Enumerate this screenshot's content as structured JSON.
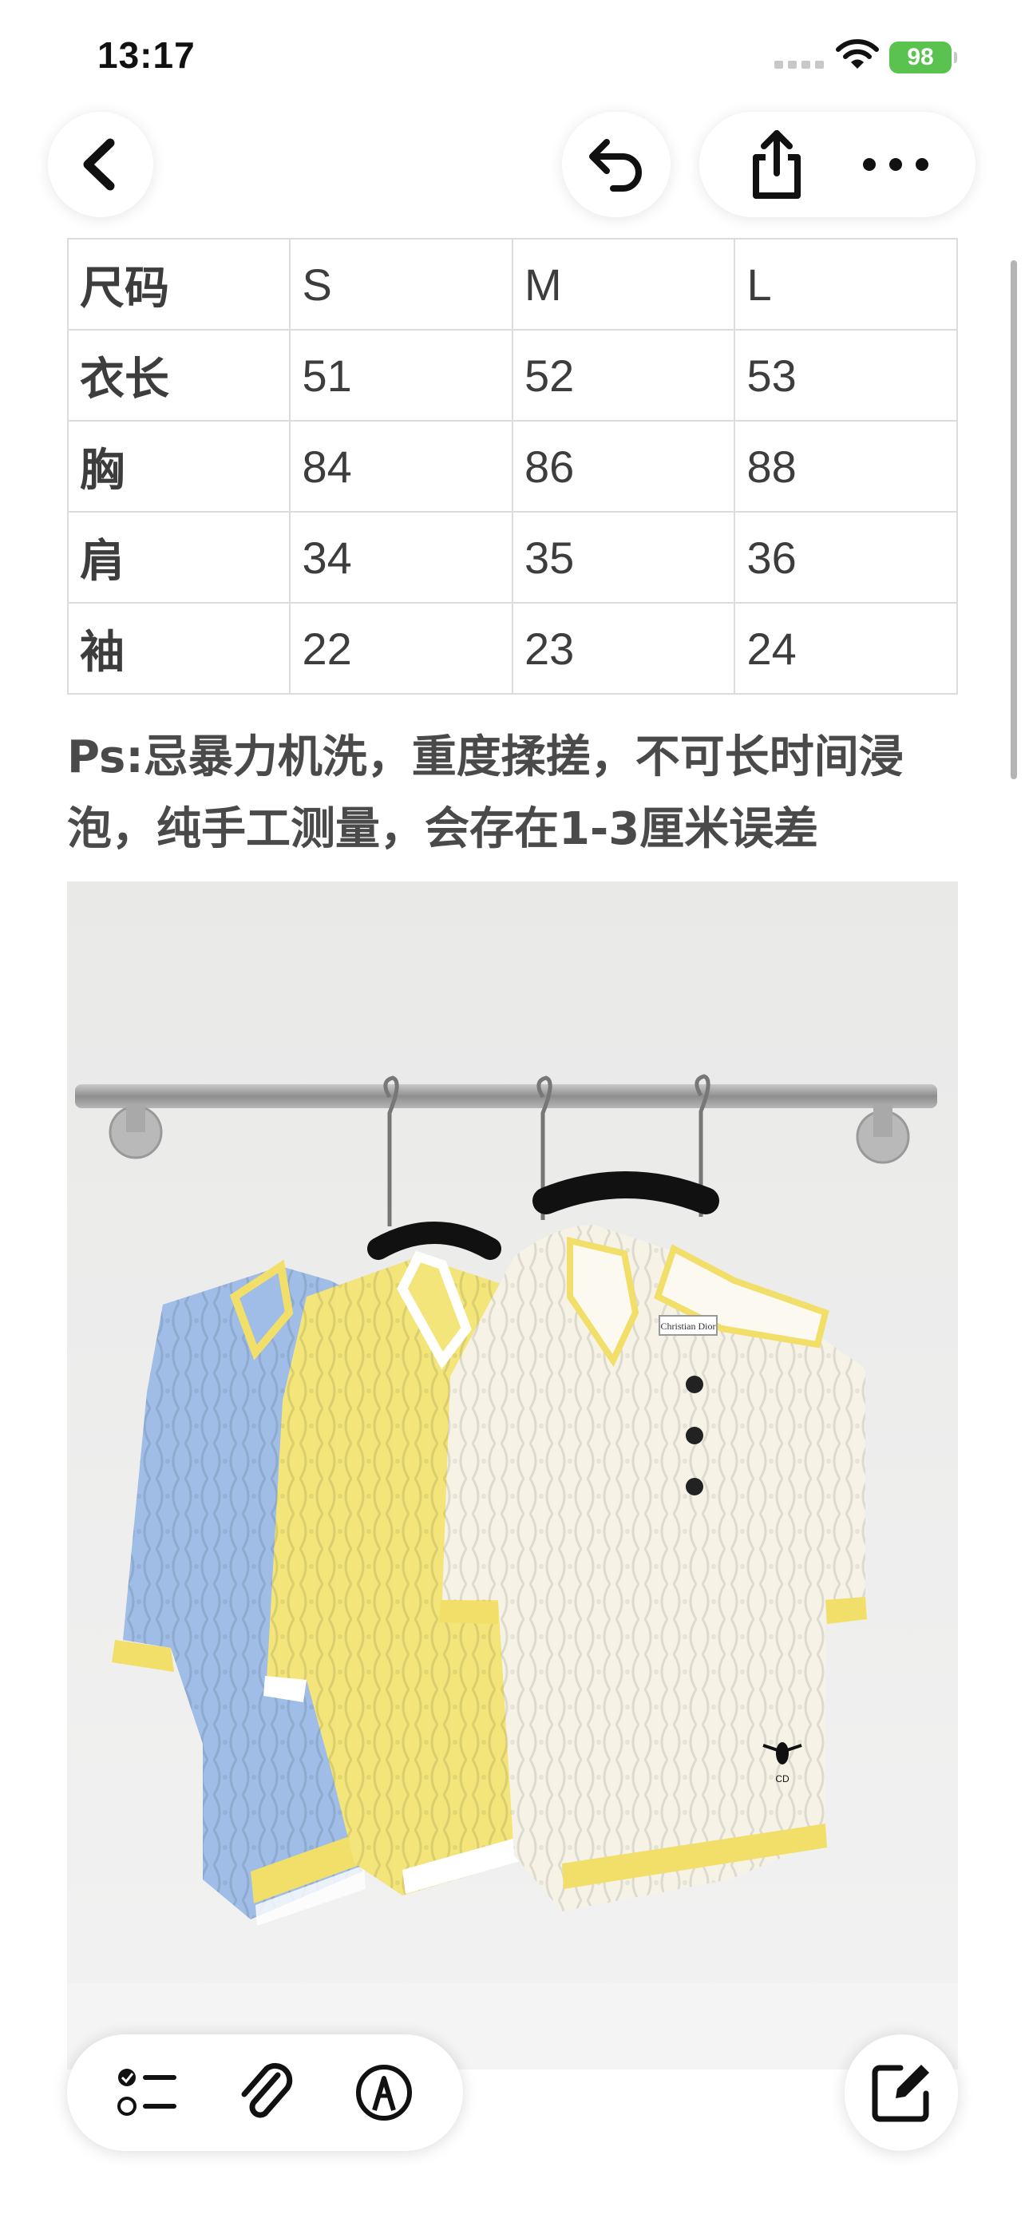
{
  "status_bar": {
    "time": "13:17",
    "battery": "98"
  },
  "nav": {
    "back_icon": "chevron-left-icon",
    "undo_icon": "undo-icon",
    "share_icon": "share-icon",
    "more_icon": "ellipsis-icon"
  },
  "table": {
    "rows": [
      [
        "尺码",
        "S",
        "M",
        "L"
      ],
      [
        "衣长",
        "51",
        "52",
        "53"
      ],
      [
        "胸",
        "84",
        "86",
        "88"
      ],
      [
        "肩",
        "34",
        "35",
        "36"
      ],
      [
        "袖",
        "22",
        "23",
        "24"
      ]
    ]
  },
  "note": {
    "line1": "Ps:忌暴力机洗，重度揉搓，不可长时间浸",
    "line2": "泡，纯手工测量，会存在1-3厘米误差"
  },
  "photo": {
    "label_text": "Christian Dior",
    "colors": [
      "#9fbde6",
      "#f3e57a",
      "#f6f3e6"
    ]
  },
  "toolbar": {
    "checklist_icon": "checklist-icon",
    "attachment_icon": "paperclip-icon",
    "markup_icon": "pen-circle-icon",
    "compose_icon": "compose-icon"
  }
}
